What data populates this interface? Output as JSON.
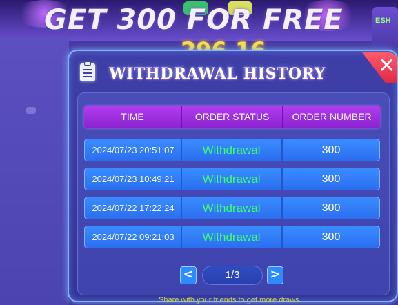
{
  "banner": {
    "text": "GET 300 FOR FREE"
  },
  "background_score": "296.16",
  "dialog": {
    "title": "WITHDRAWAL HISTORY",
    "close_label": "✕"
  },
  "table": {
    "headers": [
      "TIME",
      "ORDER STATUS",
      "ORDER NUMBER"
    ],
    "rows": [
      {
        "time": "2024/07/23 20:51:07",
        "status": "Withdrawal",
        "order": "300"
      },
      {
        "time": "2024/07/23 10:49:21",
        "status": "Withdrawal",
        "order": "300"
      },
      {
        "time": "2024/07/22 17:22:24",
        "status": "Withdrawal",
        "order": "300"
      },
      {
        "time": "2024/07/22 09:21:03",
        "status": "Withdrawal",
        "order": "300"
      }
    ]
  },
  "pager": {
    "prev": "<",
    "page": "1/3",
    "next": ">"
  },
  "footer": "Share with your friends to get more draws",
  "colors": {
    "header_purple": "#a12fe0",
    "row_blue": "#3380fa",
    "status_green": "#3dff6a",
    "close_red": "#e02a48"
  }
}
